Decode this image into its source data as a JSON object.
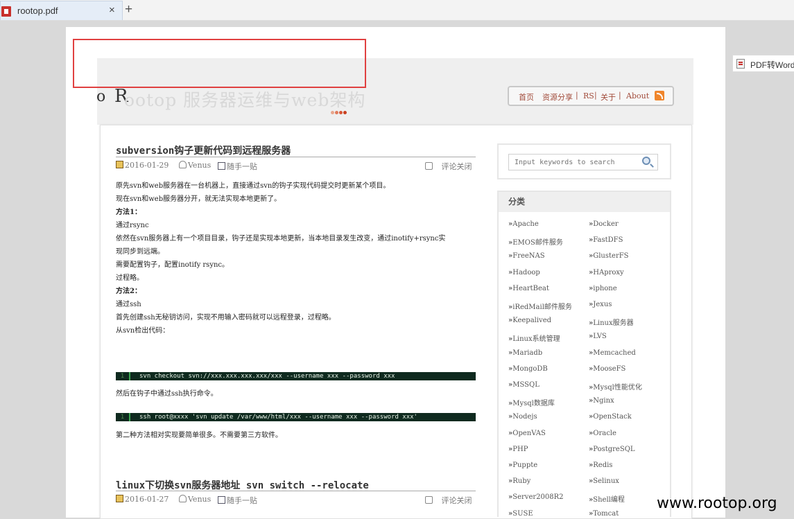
{
  "tab": {
    "title": "rootop.pdf",
    "close": "×",
    "new_tab": "+"
  },
  "header": {
    "logo_o": "o",
    "logo_r": "R",
    "logo_ghost": "ootop 服务器运维与web架构",
    "dot_colors": [
      "#e8a58c",
      "#e07a5a",
      "#d85535",
      "#c84020"
    ],
    "nav": {
      "home": "首页",
      "share": "资源分享",
      "rs": "RS",
      "about_cn": "关于",
      "about_en": "About"
    },
    "rss_icon": "rss-icon"
  },
  "post1": {
    "title": "subversion钩子更新代码到远程服务器",
    "date": "2016-01-29",
    "author": "Venus",
    "category": "随手一贴",
    "comments": "评论关闭",
    "lines": [
      "原先svn和web服务器在一台机器上，直接通过svn的钩子实现代码提交时更新某个项目。",
      "现在svn和web服务器分开，就无法实现本地更新了。",
      "",
      "方法1：",
      "通过rsync",
      "依然在svn服务器上有一个项目目录，钩子还是实现本地更新，当本地目录发生改变，通过inotify+rsync实",
      "现同步到远端。",
      "需要配置钩子，配置inotify rsync。",
      "过程略。",
      "",
      "方法2：",
      "通过ssh",
      "首先创建ssh无秘钥访问，实现不用输入密码就可以远程登录，过程略。",
      "从svn检出代码："
    ],
    "code1_num": "1",
    "code1": "svn checkout svn://xxx.xxx.xxx.xxx/xxx --username xxx --password xxx",
    "after_code1": "然后在钩子中通过ssh执行命令。",
    "code2_num": "1",
    "code2": "ssh root@xxxx 'svn update /var/www/html/xxx --username xxx --password xxx'",
    "conclusion": "第二种方法相对实现要简单很多。不需要第三方软件。"
  },
  "post2": {
    "title": "linux下切换svn服务器地址 svn switch --relocate",
    "date": "2016-01-27",
    "author": "Venus",
    "category": "随手一贴",
    "comments": "评论关闭"
  },
  "search": {
    "placeholder": "Input keywords to search"
  },
  "categories": {
    "heading": "分类",
    "left": [
      "Apache",
      "EMOS邮件服务",
      "FreeNAS",
      "Hadoop",
      "HeartBeat",
      "iRedMail邮件服务",
      "Keepalived",
      "Linux系统管理",
      "Mariadb",
      "MongoDB",
      "MSSQL",
      "Mysql数据库",
      "Nodejs",
      "OpenVAS",
      "PHP",
      "Puppte",
      "Ruby",
      "Server2008R2",
      "SUSE"
    ],
    "right": [
      "Docker",
      "FastDFS",
      "GlusterFS",
      "HAproxy",
      "iphone",
      "Jexus",
      "Linux服务器",
      "LVS",
      "Memcached",
      "MooseFS",
      "Mysql性能优化",
      "Nginx",
      "OpenStack",
      "Oracle",
      "PostgreSQL",
      "Redis",
      "Selinux",
      "Shell编程",
      "Tomcat"
    ]
  },
  "sidebar_widget": {
    "label": "PDF转Word"
  },
  "watermark": "www.rootop.org"
}
